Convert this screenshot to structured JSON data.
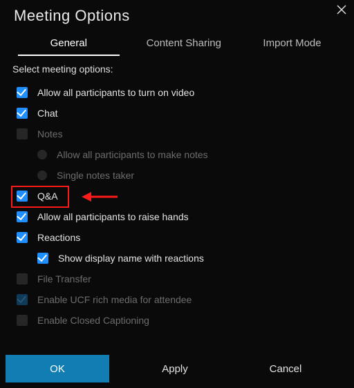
{
  "window": {
    "title": "Meeting Options"
  },
  "tabs": {
    "general": "General",
    "content_sharing": "Content Sharing",
    "import_mode": "Import Mode"
  },
  "section_label": "Select meeting options:",
  "options": {
    "allow_video": "Allow all participants to turn on video",
    "chat": "Chat",
    "notes": "Notes",
    "notes_allow_all": "Allow all participants to make notes",
    "notes_single": "Single notes taker",
    "qa": "Q&A",
    "raise_hands": "Allow all participants to raise hands",
    "reactions": "Reactions",
    "show_display_name": "Show display name with reactions",
    "file_transfer": "File Transfer",
    "enable_ucf": "Enable UCF rich media for attendee",
    "closed_captioning": "Enable Closed Captioning"
  },
  "buttons": {
    "ok": "OK",
    "apply": "Apply",
    "cancel": "Cancel"
  },
  "colors": {
    "accent": "#1f8fff",
    "primary_button": "#127db3",
    "highlight": "#ff1a1a"
  },
  "annotation": {
    "highlight_target": "qa",
    "arrow_points_to": "qa"
  }
}
